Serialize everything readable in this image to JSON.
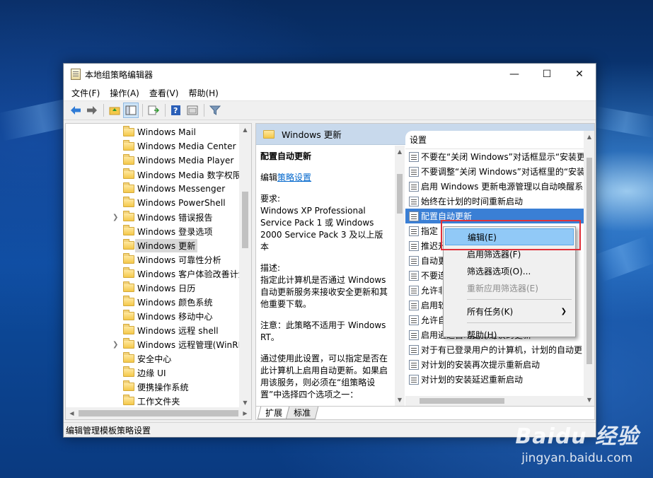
{
  "window": {
    "title": "本地组策略编辑器",
    "controls": {
      "minimize": "—",
      "maximize": "☐",
      "close": "✕"
    }
  },
  "menubar": {
    "items": [
      {
        "label": "文件(F)"
      },
      {
        "label": "操作(A)"
      },
      {
        "label": "查看(V)"
      },
      {
        "label": "帮助(H)"
      }
    ]
  },
  "tree": {
    "items": [
      {
        "label": "Windows Mail",
        "expandable": false
      },
      {
        "label": "Windows Media Center",
        "expandable": false
      },
      {
        "label": "Windows Media Player",
        "expandable": false
      },
      {
        "label": "Windows Media 数字权限",
        "expandable": false
      },
      {
        "label": "Windows Messenger",
        "expandable": false
      },
      {
        "label": "Windows PowerShell",
        "expandable": false
      },
      {
        "label": "Windows 错误报告",
        "expandable": true
      },
      {
        "label": "Windows 登录选项",
        "expandable": false
      },
      {
        "label": "Windows 更新",
        "expandable": false,
        "selected": true
      },
      {
        "label": "Windows 可靠性分析",
        "expandable": false
      },
      {
        "label": "Windows 客户体验改善计划",
        "expandable": false
      },
      {
        "label": "Windows 日历",
        "expandable": false
      },
      {
        "label": "Windows 颜色系统",
        "expandable": false
      },
      {
        "label": "Windows 移动中心",
        "expandable": false
      },
      {
        "label": "Windows 远程 shell",
        "expandable": false
      },
      {
        "label": "Windows 远程管理(WinRM)",
        "expandable": true
      },
      {
        "label": "安全中心",
        "expandable": false
      },
      {
        "label": "边缘 UI",
        "expandable": false
      },
      {
        "label": "便携操作系统",
        "expandable": false
      },
      {
        "label": "工作文件夹",
        "expandable": false
      }
    ]
  },
  "right": {
    "header": "Windows 更新",
    "desc": {
      "title": "配置自动更新",
      "edit_prefix": "编辑",
      "edit_link": "策略设置",
      "requirement_label": "要求:",
      "requirement": "Windows XP Professional Service Pack 1 或 Windows 2000 Service Pack 3 及以上版本",
      "description_label": "描述:",
      "description": "指定此计算机是否通过 Windows 自动更新服务来接收安全更新和其他重要下载。",
      "note": "注意：此策略不适用于 Windows RT。",
      "usage": "通过使用此设置，可以指定是否在此计算机上启用自动更新。如果启用该服务，则必须在“组策略设置”中选择四个选项之一："
    },
    "list": {
      "header": "设置",
      "rows": [
        {
          "label": "不要在“关闭 Windows”对话框显示“安装更"
        },
        {
          "label": "不要调整“关闭 Windows”对话框里的“安装"
        },
        {
          "label": "启用 Windows 更新电源管理以自动唤醒系"
        },
        {
          "label": "始终在计划的时间重新启动"
        },
        {
          "label": "配置自动更新",
          "selected": true
        },
        {
          "label": "指定"
        },
        {
          "label": "推迟升级"
        },
        {
          "label": "自动更"
        },
        {
          "label": "不要连"
        },
        {
          "label": "允许非"
        },
        {
          "label": "启用软"
        },
        {
          "label": "允许自"
        },
        {
          "label": "启用通过自动更新建议的更新"
        },
        {
          "label": "对于有已登录用户的计算机，计划的自动更"
        },
        {
          "label": "对计划的安装再次提示重新启动"
        },
        {
          "label": "对计划的安装延迟重新启动"
        }
      ]
    },
    "tabs": [
      {
        "label": "扩展"
      },
      {
        "label": "标准"
      }
    ]
  },
  "context_menu": {
    "items": [
      {
        "label": "编辑(E)",
        "highlighted": true
      },
      {
        "label": "启用筛选器(F)"
      },
      {
        "label": "筛选器选项(O)..."
      },
      {
        "label": "重新应用筛选器(E)",
        "disabled": true
      },
      {
        "separator": true
      },
      {
        "label": "所有任务(K)",
        "submenu": true
      },
      {
        "separator": true
      },
      {
        "label": "帮助(H)"
      }
    ]
  },
  "statusbar": {
    "text": "编辑管理模板策略设置"
  },
  "watermark": {
    "logo": "Baidu 经验",
    "url": "jingyan.baidu.com"
  },
  "colors": {
    "selection": "#3a7fd5",
    "menu_highlight": "#91c9f7",
    "annotation_red": "#e0303a",
    "header_blue": "#c8d9ec"
  }
}
